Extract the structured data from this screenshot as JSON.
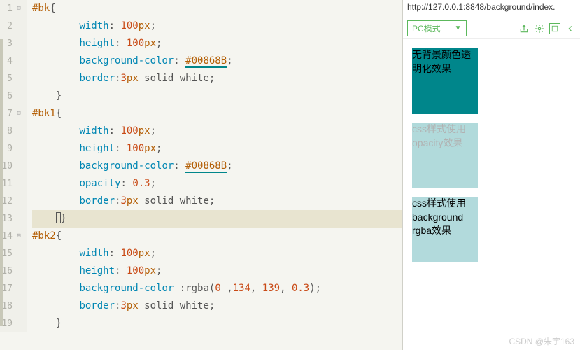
{
  "code": {
    "lines": [
      {
        "n": 1,
        "fold": true,
        "tokens": [
          [
            "selector",
            "#bk"
          ],
          [
            "brace",
            "{"
          ]
        ]
      },
      {
        "n": 2,
        "fold": false,
        "indent": 2,
        "tokens": [
          [
            "prop",
            "width"
          ],
          [
            "colon",
            ": "
          ],
          [
            "number",
            "100"
          ],
          [
            "unit",
            "px"
          ],
          [
            "semicolon",
            ";"
          ]
        ]
      },
      {
        "n": 3,
        "fold": false,
        "indent": 2,
        "tokens": [
          [
            "prop",
            "height"
          ],
          [
            "colon",
            ": "
          ],
          [
            "number",
            "100"
          ],
          [
            "unit",
            "px"
          ],
          [
            "semicolon",
            ";"
          ]
        ]
      },
      {
        "n": 4,
        "fold": false,
        "indent": 2,
        "tokens": [
          [
            "prop",
            "background-color"
          ],
          [
            "colon",
            ": "
          ],
          [
            "color",
            "#00868B"
          ],
          [
            "semicolon",
            ";"
          ]
        ]
      },
      {
        "n": 5,
        "fold": false,
        "indent": 2,
        "tokens": [
          [
            "prop",
            "border"
          ],
          [
            "colon",
            ":"
          ],
          [
            "number",
            "3"
          ],
          [
            "unit",
            "px"
          ],
          [
            "value",
            " solid white"
          ],
          [
            "semicolon",
            ";"
          ]
        ]
      },
      {
        "n": 6,
        "fold": false,
        "indent": 1,
        "tokens": [
          [
            "brace",
            "}"
          ]
        ]
      },
      {
        "n": 7,
        "fold": true,
        "tokens": [
          [
            "selector",
            "#bk1"
          ],
          [
            "brace",
            "{"
          ]
        ],
        "cursor_after_brace": true
      },
      {
        "n": 8,
        "fold": false,
        "indent": 2,
        "tokens": [
          [
            "prop",
            "width"
          ],
          [
            "colon",
            ": "
          ],
          [
            "number",
            "100"
          ],
          [
            "unit",
            "px"
          ],
          [
            "semicolon",
            ";"
          ]
        ]
      },
      {
        "n": 9,
        "fold": false,
        "indent": 2,
        "tokens": [
          [
            "prop",
            "height"
          ],
          [
            "colon",
            ": "
          ],
          [
            "number",
            "100"
          ],
          [
            "unit",
            "px"
          ],
          [
            "semicolon",
            ";"
          ]
        ]
      },
      {
        "n": 10,
        "fold": false,
        "indent": 2,
        "tokens": [
          [
            "prop",
            "background-color"
          ],
          [
            "colon",
            ": "
          ],
          [
            "color",
            "#00868B"
          ],
          [
            "semicolon",
            ";"
          ]
        ]
      },
      {
        "n": 11,
        "fold": false,
        "indent": 2,
        "tokens": [
          [
            "prop",
            "opacity"
          ],
          [
            "colon",
            ": "
          ],
          [
            "number",
            "0.3"
          ],
          [
            "semicolon",
            ";"
          ]
        ]
      },
      {
        "n": 12,
        "fold": false,
        "indent": 2,
        "tokens": [
          [
            "prop",
            "border"
          ],
          [
            "colon",
            ":"
          ],
          [
            "number",
            "3"
          ],
          [
            "unit",
            "px"
          ],
          [
            "value",
            " solid white"
          ],
          [
            "semicolon",
            ";"
          ]
        ]
      },
      {
        "n": 13,
        "fold": false,
        "indent": 1,
        "highlighted": true,
        "tokens": [
          [
            "brace",
            "}"
          ]
        ],
        "cursor": true
      },
      {
        "n": 14,
        "fold": true,
        "tokens": [
          [
            "selector",
            "#bk2"
          ],
          [
            "brace",
            "{"
          ]
        ]
      },
      {
        "n": 15,
        "fold": false,
        "indent": 2,
        "tokens": [
          [
            "prop",
            "width"
          ],
          [
            "colon",
            ": "
          ],
          [
            "number",
            "100"
          ],
          [
            "unit",
            "px"
          ],
          [
            "semicolon",
            ";"
          ]
        ]
      },
      {
        "n": 16,
        "fold": false,
        "indent": 2,
        "tokens": [
          [
            "prop",
            "height"
          ],
          [
            "colon",
            ": "
          ],
          [
            "number",
            "100"
          ],
          [
            "unit",
            "px"
          ],
          [
            "semicolon",
            ";"
          ]
        ]
      },
      {
        "n": 17,
        "fold": false,
        "indent": 2,
        "tokens": [
          [
            "prop",
            "background-color"
          ],
          [
            "value",
            " :"
          ],
          [
            "func",
            "rgba"
          ],
          [
            "brace",
            "("
          ],
          [
            "number",
            "0"
          ],
          [
            "value",
            " "
          ],
          [
            "comma",
            ","
          ],
          [
            "number",
            "134"
          ],
          [
            "comma",
            ", "
          ],
          [
            "number",
            "139"
          ],
          [
            "comma",
            ", "
          ],
          [
            "number",
            "0.3"
          ],
          [
            "brace",
            ")"
          ],
          [
            "semicolon",
            ";"
          ]
        ]
      },
      {
        "n": 18,
        "fold": false,
        "indent": 2,
        "tokens": [
          [
            "prop",
            "border"
          ],
          [
            "colon",
            ":"
          ],
          [
            "number",
            "3"
          ],
          [
            "unit",
            "px"
          ],
          [
            "value",
            " solid white"
          ],
          [
            "semicolon",
            ";"
          ]
        ]
      },
      {
        "n": 19,
        "fold": false,
        "indent": 1,
        "tokens": [
          [
            "brace",
            "}"
          ]
        ]
      }
    ]
  },
  "preview": {
    "address": "http://127.0.0.1:8848/background/index.",
    "mode_label": "PC模式",
    "boxes": {
      "b1_text": "无背景颜色透明化效果",
      "b2_text": "css样式使用opacity效果",
      "b3_text": "css样式使用background rgba效果"
    }
  },
  "watermark": "CSDN @朱宇163"
}
